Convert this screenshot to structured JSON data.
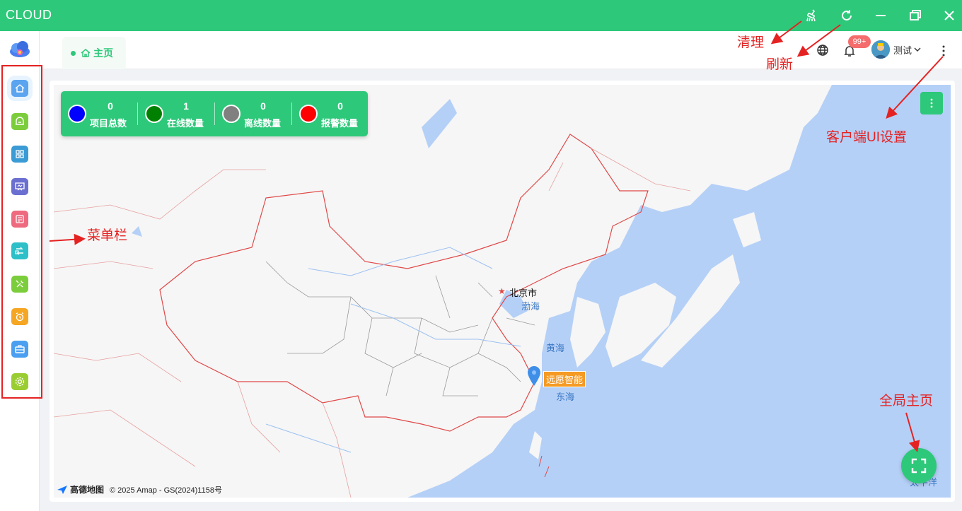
{
  "window": {
    "title": "CLOUD",
    "controls": [
      "broom-icon",
      "refresh-icon",
      "minimize-icon",
      "restore-icon",
      "close-icon"
    ]
  },
  "sidebar": {
    "items": [
      {
        "name": "home",
        "icon": "home-icon",
        "color": "#5aa4f0"
      },
      {
        "name": "project",
        "icon": "project-icon",
        "color": "#7ccd3c"
      },
      {
        "name": "grid",
        "icon": "grid-icon",
        "color": "#3a9bd5"
      },
      {
        "name": "monitor",
        "icon": "board-icon",
        "color": "#6b6fd0"
      },
      {
        "name": "report",
        "icon": "report-icon",
        "color": "#ee6a7f"
      },
      {
        "name": "transfer",
        "icon": "transfer-icon",
        "color": "#2ec0c8"
      },
      {
        "name": "tools",
        "icon": "wrench-icon",
        "color": "#7ccd3c"
      },
      {
        "name": "alarm",
        "icon": "alarm-icon",
        "color": "#f5a623"
      },
      {
        "name": "case",
        "icon": "briefcase-icon",
        "color": "#4a9ff0"
      },
      {
        "name": "settings",
        "icon": "settings-icon",
        "color": "#9acd32"
      }
    ]
  },
  "header": {
    "tab_home": "主页",
    "notification_badge": "99+",
    "user_name": "测试"
  },
  "stats": [
    {
      "value": "0",
      "label": "项目总数",
      "color": "#0000ff"
    },
    {
      "value": "1",
      "label": "在线数量",
      "color": "#008000"
    },
    {
      "value": "0",
      "label": "离线数量",
      "color": "#808080"
    },
    {
      "value": "0",
      "label": "报警数量",
      "color": "#ff0000"
    }
  ],
  "map": {
    "labels": {
      "beijing": "北京市",
      "bohai": "渤海",
      "yellow_sea": "黄海",
      "east_sea": "东海",
      "marker": "远愿智能",
      "ocean": "太平洋"
    },
    "logo": "高德地图",
    "copyright": "© 2025 Amap - GS(2024)1158号"
  },
  "annotations": {
    "clean": "清理",
    "refresh": "刷新",
    "ui_settings": "客户端UI设置",
    "menu_bar": "菜单栏",
    "global_home": "全局主页"
  }
}
